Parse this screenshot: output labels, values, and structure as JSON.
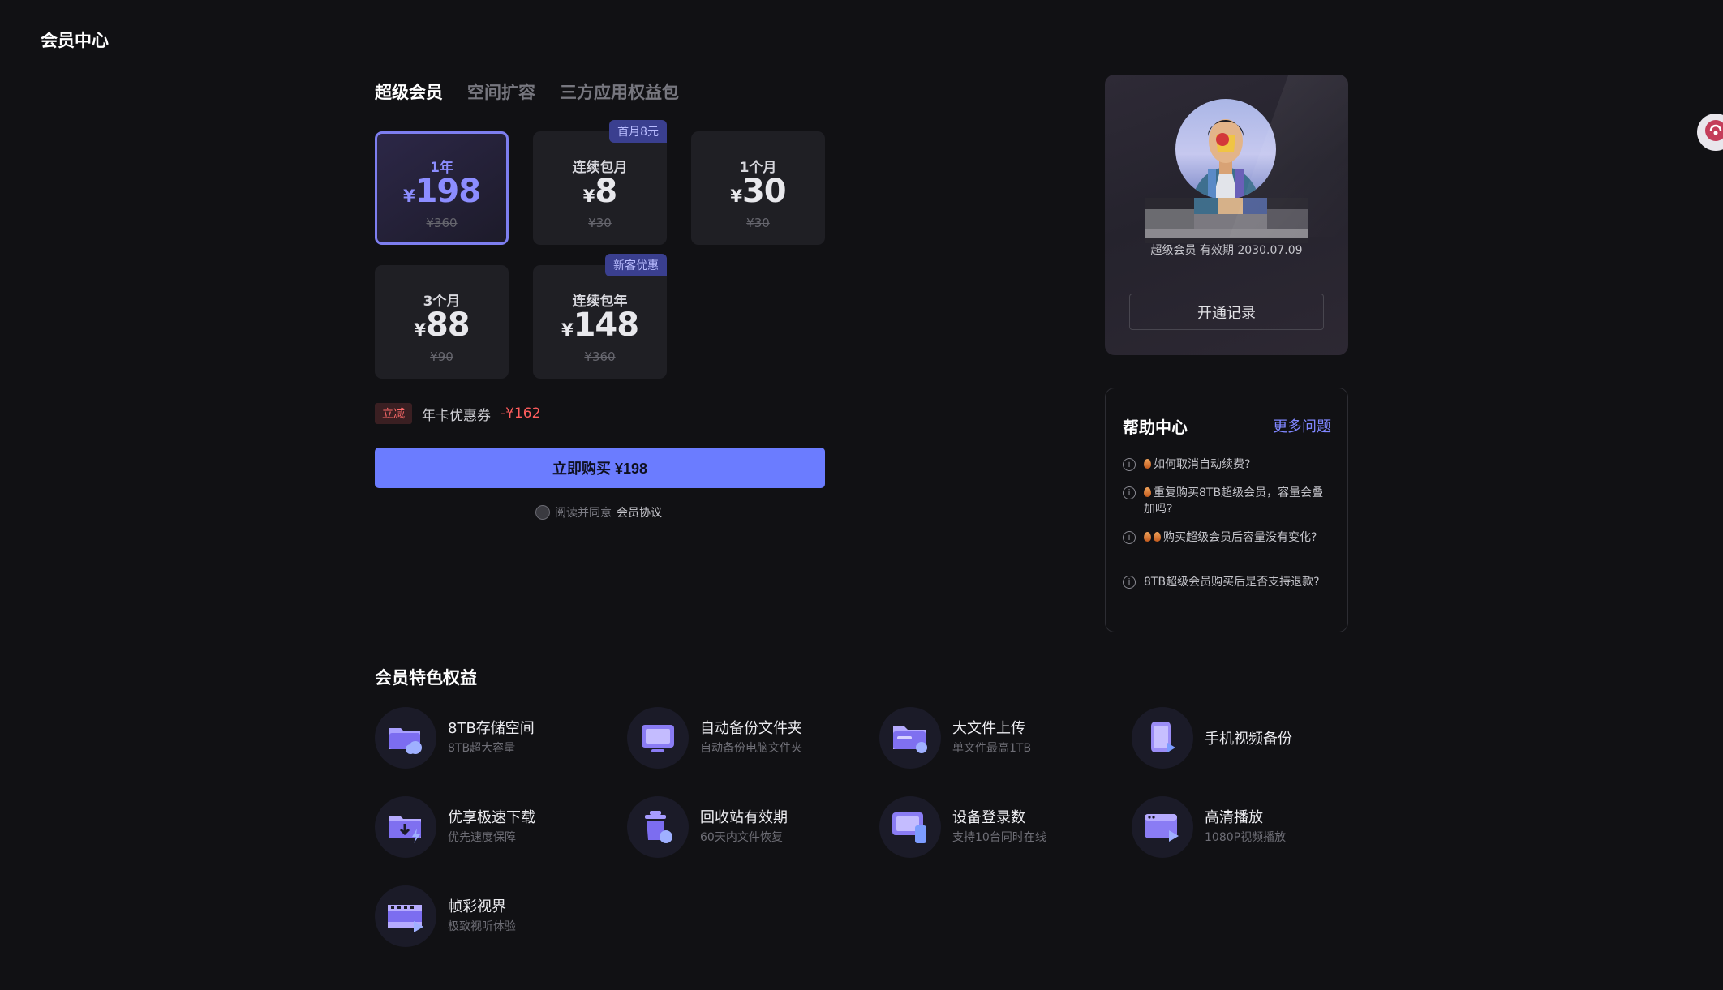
{
  "header": {
    "title": "会员中心"
  },
  "tabs": [
    {
      "label": "超级会员"
    },
    {
      "label": "空间扩容"
    },
    {
      "label": "三方应用权益包"
    }
  ],
  "plans": [
    {
      "name": "1年",
      "currency": "¥",
      "price": "198",
      "original": "¥360",
      "badge": ""
    },
    {
      "name": "连续包月",
      "currency": "¥",
      "price": "8",
      "original": "¥30",
      "badge": "首月8元"
    },
    {
      "name": "1个月",
      "currency": "¥",
      "price": "30",
      "original": "¥30",
      "badge": ""
    },
    {
      "name": "3个月",
      "currency": "¥",
      "price": "88",
      "original": "¥90",
      "badge": ""
    },
    {
      "name": "连续包年",
      "currency": "¥",
      "price": "148",
      "original": "¥360",
      "badge": "新客优惠"
    }
  ],
  "coupon": {
    "tag": "立减",
    "text": "年卡优惠券",
    "amount": "-¥162"
  },
  "buy_button": {
    "label": "立即购买 ¥198"
  },
  "agreement": {
    "prefix": "阅读并同意",
    "link": "会员协议"
  },
  "profile": {
    "membership": "超级会员 有效期 2030.07.09",
    "records_button": "开通记录"
  },
  "help": {
    "title": "帮助中心",
    "more": "更多问题",
    "items": [
      {
        "text": "如何取消自动续费?"
      },
      {
        "text": "重复购买8TB超级会员，容量会叠加吗?"
      },
      {
        "text": "购买超级会员后容量没有变化?"
      },
      {
        "text": "8TB超级会员购买后是否支持退款?"
      }
    ]
  },
  "benefits": {
    "title": "会员特色权益",
    "items": [
      {
        "name": "8TB存储空间",
        "desc": "8TB超大容量",
        "icon": "cloud-folder-icon"
      },
      {
        "name": "自动备份文件夹",
        "desc": "自动备份电脑文件夹",
        "icon": "monitor-icon"
      },
      {
        "name": "大文件上传",
        "desc": "单文件最高1TB",
        "icon": "folder-upload-icon"
      },
      {
        "name": "手机视频备份",
        "desc": "",
        "icon": "phone-video-icon"
      },
      {
        "name": "优享极速下载",
        "desc": "优先速度保障",
        "icon": "fast-download-icon"
      },
      {
        "name": "回收站有效期",
        "desc": "60天内文件恢复",
        "icon": "recycle-bin-icon"
      },
      {
        "name": "设备登录数",
        "desc": "支持10台同时在线",
        "icon": "devices-icon"
      },
      {
        "name": "高清播放",
        "desc": "1080P视频播放",
        "icon": "hd-play-icon"
      },
      {
        "name": "帧彩视界",
        "desc": "极致视听体验",
        "icon": "film-icon"
      }
    ]
  },
  "colors": {
    "accent": "#6b7cff",
    "background": "#111114",
    "card": "#1f1f24",
    "discount": "#ff5d5d"
  }
}
